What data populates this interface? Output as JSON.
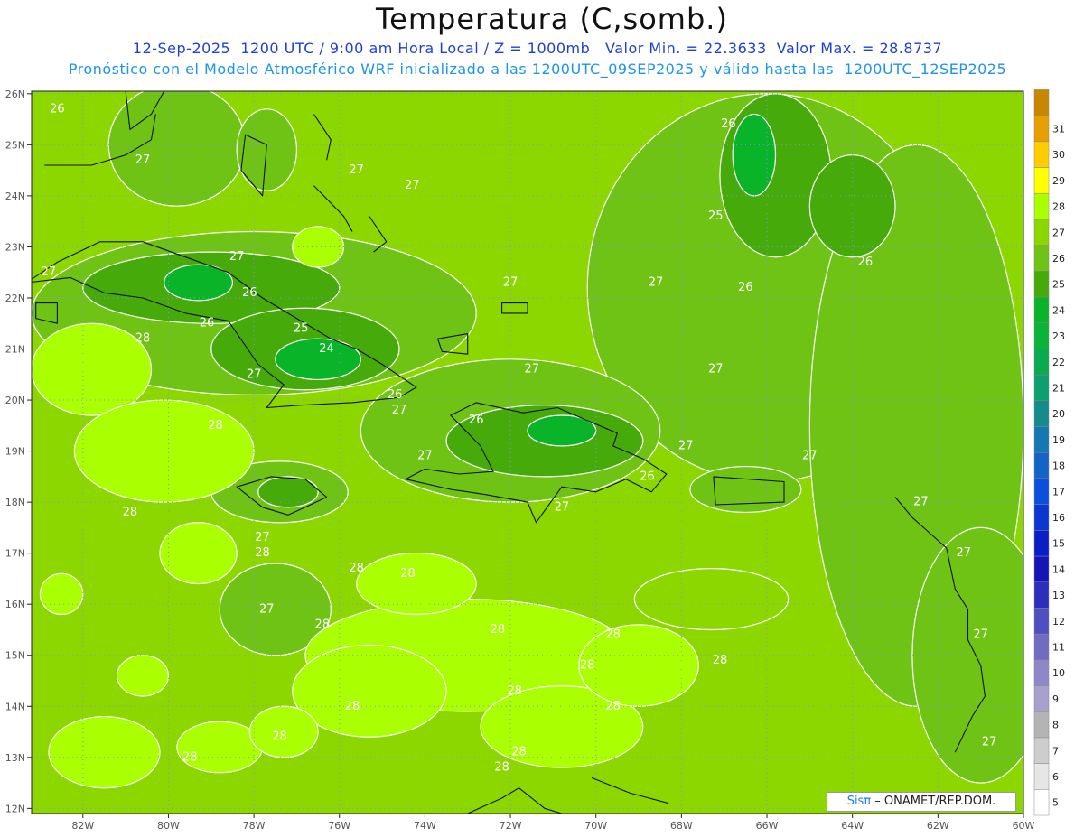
{
  "title": "Temperatura (C,somb.)",
  "subtitle_line1": "12-Sep-2025  1200 UTC / 9:00 am Hora Local / Z = 1000mb   Valor Min. = 22.3633  Valor Max. = 28.8737",
  "subtitle_line2": "Pronóstico con el Modelo Atmosférico WRF inicializado a las 1200UTC_09SEP2025 y válido hasta las  1200UTC_12SEP2025",
  "credit": {
    "brand": "Sisπ",
    "org": " – ONAMET/REP.DOM."
  },
  "map": {
    "lon_ticks": [
      "82W",
      "80W",
      "78W",
      "76W",
      "74W",
      "72W",
      "70W",
      "68W",
      "66W",
      "64W",
      "62W",
      "60W"
    ],
    "lat_ticks": [
      "12N",
      "13N",
      "14N",
      "15N",
      "16N",
      "17N",
      "18N",
      "19N",
      "20N",
      "21N",
      "22N",
      "23N",
      "24N",
      "25N",
      "26N"
    ],
    "lon_values": [
      -82,
      -80,
      -78,
      -76,
      -74,
      -72,
      -70,
      -68,
      -66,
      -64,
      -62,
      -60
    ],
    "lat_values": [
      12,
      13,
      14,
      15,
      16,
      17,
      18,
      19,
      20,
      21,
      22,
      23,
      24,
      25,
      26
    ],
    "lon_range": [
      -83.2,
      -60
    ],
    "lat_range": [
      11.9,
      26.05
    ],
    "background_level": 27,
    "regions": [
      {
        "level": 26,
        "lon": -66,
        "lat": 22.2,
        "rx": 4.2,
        "ry": 3.8
      },
      {
        "level": 26,
        "lon": -62.5,
        "lat": 19.5,
        "rx": 2.5,
        "ry": 5.5
      },
      {
        "level": 26,
        "lon": -61,
        "lat": 15,
        "rx": 1.6,
        "ry": 2.5
      },
      {
        "level": 25,
        "lon": -65.8,
        "lat": 24.4,
        "rx": 1.3,
        "ry": 1.6
      },
      {
        "level": 25,
        "lon": -64,
        "lat": 23.8,
        "rx": 1,
        "ry": 1
      },
      {
        "level": 24,
        "lon": -66.3,
        "lat": 24.8,
        "rx": 0.5,
        "ry": 0.8
      },
      {
        "level": 26,
        "lon": -78,
        "lat": 21.7,
        "rx": 5.2,
        "ry": 1.6
      },
      {
        "level": 25,
        "lon": -79,
        "lat": 22.2,
        "rx": 3,
        "ry": 0.7
      },
      {
        "level": 25,
        "lon": -76.8,
        "lat": 21,
        "rx": 2.2,
        "ry": 0.8
      },
      {
        "level": 24,
        "lon": -79.3,
        "lat": 22.3,
        "rx": 0.8,
        "ry": 0.35
      },
      {
        "level": 24,
        "lon": -76.5,
        "lat": 20.8,
        "rx": 1,
        "ry": 0.4
      },
      {
        "level": 26,
        "lon": -72,
        "lat": 19.4,
        "rx": 3.5,
        "ry": 1.4
      },
      {
        "level": 25,
        "lon": -71.2,
        "lat": 19.2,
        "rx": 2.3,
        "ry": 0.7
      },
      {
        "level": 24,
        "lon": -70.8,
        "lat": 19.4,
        "rx": 0.8,
        "ry": 0.3
      },
      {
        "level": 26,
        "lon": -66.5,
        "lat": 18.25,
        "rx": 1.3,
        "ry": 0.45
      },
      {
        "level": 26,
        "lon": -77.4,
        "lat": 18.2,
        "rx": 1.6,
        "ry": 0.6
      },
      {
        "level": 25,
        "lon": -77.2,
        "lat": 18.2,
        "rx": 0.7,
        "ry": 0.3
      },
      {
        "level": 26,
        "lon": -77.5,
        "lat": 15.9,
        "rx": 1.3,
        "ry": 0.9
      },
      {
        "level": 26,
        "lon": -79.8,
        "lat": 25,
        "rx": 1.6,
        "ry": 1.2
      },
      {
        "level": 26,
        "lon": -77.7,
        "lat": 24.9,
        "rx": 0.7,
        "ry": 0.8
      },
      {
        "level": 27,
        "lon": -67.3,
        "lat": 16.1,
        "rx": 1.8,
        "ry": 0.6
      },
      {
        "level": 28,
        "lon": -81.8,
        "lat": 20.6,
        "rx": 1.4,
        "ry": 0.9
      },
      {
        "level": 28,
        "lon": -80.1,
        "lat": 19,
        "rx": 2.1,
        "ry": 1
      },
      {
        "level": 28,
        "lon": -76.5,
        "lat": 23,
        "rx": 0.6,
        "ry": 0.4
      },
      {
        "level": 28,
        "lon": -73,
        "lat": 15,
        "rx": 3.8,
        "ry": 1.1
      },
      {
        "level": 28,
        "lon": -75.3,
        "lat": 14.3,
        "rx": 1.8,
        "ry": 0.9
      },
      {
        "level": 28,
        "lon": -70.8,
        "lat": 13.6,
        "rx": 1.9,
        "ry": 0.8
      },
      {
        "level": 28,
        "lon": -69,
        "lat": 14.8,
        "rx": 1.4,
        "ry": 0.8
      },
      {
        "level": 28,
        "lon": -74.2,
        "lat": 16.4,
        "rx": 1.4,
        "ry": 0.6
      },
      {
        "level": 28,
        "lon": -79.3,
        "lat": 17,
        "rx": 0.9,
        "ry": 0.6
      },
      {
        "level": 28,
        "lon": -81.5,
        "lat": 13.1,
        "rx": 1.3,
        "ry": 0.7
      },
      {
        "level": 28,
        "lon": -78.8,
        "lat": 13.2,
        "rx": 1,
        "ry": 0.5
      },
      {
        "level": 28,
        "lon": -77.3,
        "lat": 13.5,
        "rx": 0.8,
        "ry": 0.5
      },
      {
        "level": 28,
        "lon": -82.5,
        "lat": 16.2,
        "rx": 0.5,
        "ry": 0.4
      },
      {
        "level": 28,
        "lon": -80.6,
        "lat": 14.6,
        "rx": 0.6,
        "ry": 0.4
      }
    ],
    "contour_labels": [
      {
        "text": "26",
        "lon": -82.6,
        "lat": 25.7
      },
      {
        "text": "27",
        "lon": -80.6,
        "lat": 24.7
      },
      {
        "text": "27",
        "lon": -78.4,
        "lat": 22.8
      },
      {
        "text": "27",
        "lon": -82.8,
        "lat": 22.5
      },
      {
        "text": "26",
        "lon": -78.1,
        "lat": 22.1
      },
      {
        "text": "26",
        "lon": -79.1,
        "lat": 21.5
      },
      {
        "text": "25",
        "lon": -76.9,
        "lat": 21.4
      },
      {
        "text": "24",
        "lon": -76.3,
        "lat": 21
      },
      {
        "text": "27",
        "lon": -78,
        "lat": 20.5
      },
      {
        "text": "26",
        "lon": -74.7,
        "lat": 20.1
      },
      {
        "text": "27",
        "lon": -74.6,
        "lat": 19.8
      },
      {
        "text": "28",
        "lon": -80.6,
        "lat": 21.2
      },
      {
        "text": "28",
        "lon": -78.9,
        "lat": 19.5
      },
      {
        "text": "27",
        "lon": -74.3,
        "lat": 24.2
      },
      {
        "text": "27",
        "lon": -75.6,
        "lat": 24.5
      },
      {
        "text": "27",
        "lon": -72,
        "lat": 22.3
      },
      {
        "text": "27",
        "lon": -68.6,
        "lat": 22.3
      },
      {
        "text": "27",
        "lon": -71.5,
        "lat": 20.6
      },
      {
        "text": "26",
        "lon": -72.8,
        "lat": 19.6
      },
      {
        "text": "27",
        "lon": -74,
        "lat": 18.9
      },
      {
        "text": "27",
        "lon": -67.9,
        "lat": 19.1
      },
      {
        "text": "26",
        "lon": -68.8,
        "lat": 18.5
      },
      {
        "text": "27",
        "lon": -70.8,
        "lat": 17.9
      },
      {
        "text": "27",
        "lon": -65,
        "lat": 18.9
      },
      {
        "text": "26",
        "lon": -66.9,
        "lat": 25.4
      },
      {
        "text": "25",
        "lon": -67.2,
        "lat": 23.6
      },
      {
        "text": "26",
        "lon": -63.7,
        "lat": 22.7
      },
      {
        "text": "26",
        "lon": -66.5,
        "lat": 22.2
      },
      {
        "text": "27",
        "lon": -67.2,
        "lat": 20.6
      },
      {
        "text": "27",
        "lon": -62.4,
        "lat": 18
      },
      {
        "text": "27",
        "lon": -61.4,
        "lat": 17
      },
      {
        "text": "27",
        "lon": -61,
        "lat": 15.4
      },
      {
        "text": "27",
        "lon": -60.8,
        "lat": 13.3
      },
      {
        "text": "28",
        "lon": -80.9,
        "lat": 17.8
      },
      {
        "text": "27",
        "lon": -77.8,
        "lat": 17.3
      },
      {
        "text": "28",
        "lon": -77.8,
        "lat": 17
      },
      {
        "text": "27",
        "lon": -77.7,
        "lat": 15.9
      },
      {
        "text": "28",
        "lon": -74.4,
        "lat": 16.6
      },
      {
        "text": "28",
        "lon": -75.6,
        "lat": 16.7
      },
      {
        "text": "28",
        "lon": -76.4,
        "lat": 15.6
      },
      {
        "text": "28",
        "lon": -72.3,
        "lat": 15.5
      },
      {
        "text": "28",
        "lon": -69.6,
        "lat": 15.4
      },
      {
        "text": "28",
        "lon": -70.2,
        "lat": 14.8
      },
      {
        "text": "28",
        "lon": -67.1,
        "lat": 14.9
      },
      {
        "text": "28",
        "lon": -71.9,
        "lat": 14.3
      },
      {
        "text": "28",
        "lon": -69.6,
        "lat": 14
      },
      {
        "text": "28",
        "lon": -75.7,
        "lat": 14
      },
      {
        "text": "28",
        "lon": -77.4,
        "lat": 13.4
      },
      {
        "text": "28",
        "lon": -79.5,
        "lat": 13
      },
      {
        "text": "28",
        "lon": -71.8,
        "lat": 13.1
      },
      {
        "text": "28",
        "lon": -72.2,
        "lat": 12.8
      }
    ],
    "land_outlines": [
      {
        "name": "cuba",
        "closed": true,
        "points": [
          [
            -84.9,
            21.9
          ],
          [
            -83.5,
            22.2
          ],
          [
            -82.6,
            22.7
          ],
          [
            -81.6,
            23.1
          ],
          [
            -80.6,
            23.1
          ],
          [
            -79.6,
            22.8
          ],
          [
            -78.6,
            22.5
          ],
          [
            -77.8,
            22.0
          ],
          [
            -77.0,
            21.6
          ],
          [
            -76.2,
            21.2
          ],
          [
            -75.6,
            21.0
          ],
          [
            -75.0,
            20.7
          ],
          [
            -74.2,
            20.25
          ],
          [
            -74.6,
            20.05
          ],
          [
            -75.7,
            19.95
          ],
          [
            -76.9,
            19.9
          ],
          [
            -77.7,
            19.85
          ],
          [
            -77.3,
            20.3
          ],
          [
            -77.9,
            20.7
          ],
          [
            -78.6,
            21.55
          ],
          [
            -79.6,
            21.7
          ],
          [
            -80.6,
            22.0
          ],
          [
            -81.5,
            22.1
          ],
          [
            -82.3,
            22.4
          ],
          [
            -83.3,
            22.3
          ],
          [
            -84.4,
            21.9
          ]
        ]
      },
      {
        "name": "isla-juventud",
        "closed": true,
        "points": [
          [
            -83.1,
            21.9
          ],
          [
            -82.6,
            21.9
          ],
          [
            -82.6,
            21.5
          ],
          [
            -83.1,
            21.6
          ]
        ]
      },
      {
        "name": "hispaniola",
        "closed": true,
        "points": [
          [
            -74.45,
            18.45
          ],
          [
            -73.4,
            18.25
          ],
          [
            -72.6,
            18.15
          ],
          [
            -71.6,
            18.0
          ],
          [
            -71.4,
            17.6
          ],
          [
            -70.8,
            18.3
          ],
          [
            -70.0,
            18.2
          ],
          [
            -69.3,
            18.45
          ],
          [
            -68.7,
            18.2
          ],
          [
            -68.35,
            18.55
          ],
          [
            -68.9,
            18.85
          ],
          [
            -69.6,
            19.1
          ],
          [
            -69.5,
            19.35
          ],
          [
            -70.2,
            19.6
          ],
          [
            -70.9,
            19.85
          ],
          [
            -71.7,
            19.75
          ],
          [
            -72.8,
            19.95
          ],
          [
            -73.4,
            19.7
          ],
          [
            -72.7,
            19.1
          ],
          [
            -72.4,
            18.6
          ],
          [
            -73.2,
            18.55
          ],
          [
            -74.0,
            18.65
          ]
        ]
      },
      {
        "name": "jamaica",
        "closed": true,
        "points": [
          [
            -78.4,
            18.3
          ],
          [
            -77.6,
            18.5
          ],
          [
            -76.8,
            18.45
          ],
          [
            -76.3,
            18.1
          ],
          [
            -76.8,
            17.9
          ],
          [
            -77.2,
            17.75
          ],
          [
            -77.8,
            17.9
          ]
        ]
      },
      {
        "name": "puerto-rico",
        "closed": true,
        "points": [
          [
            -67.25,
            18.5
          ],
          [
            -65.6,
            18.4
          ],
          [
            -65.6,
            18.0
          ],
          [
            -67.2,
            17.95
          ]
        ]
      },
      {
        "name": "andros",
        "closed": true,
        "points": [
          [
            -78.2,
            25.2
          ],
          [
            -77.7,
            25.0
          ],
          [
            -77.8,
            24.0
          ],
          [
            -78.3,
            24.5
          ]
        ]
      },
      {
        "name": "eleuthera",
        "closed": false,
        "points": [
          [
            -76.6,
            25.6
          ],
          [
            -76.2,
            25.1
          ],
          [
            -76.3,
            24.7
          ]
        ]
      },
      {
        "name": "great-exuma",
        "closed": false,
        "points": [
          [
            -76.6,
            24.2
          ],
          [
            -75.9,
            23.6
          ],
          [
            -75.7,
            23.3
          ]
        ]
      },
      {
        "name": "long-island",
        "closed": false,
        "points": [
          [
            -75.3,
            23.6
          ],
          [
            -74.9,
            23.1
          ],
          [
            -75.2,
            22.9
          ]
        ]
      },
      {
        "name": "inagua",
        "closed": true,
        "points": [
          [
            -73.7,
            21.2
          ],
          [
            -73.0,
            21.3
          ],
          [
            -73.0,
            20.9
          ],
          [
            -73.6,
            20.95
          ]
        ]
      },
      {
        "name": "turks-caicos",
        "closed": true,
        "points": [
          [
            -72.2,
            21.9
          ],
          [
            -71.6,
            21.9
          ],
          [
            -71.6,
            21.7
          ],
          [
            -72.2,
            21.7
          ]
        ]
      },
      {
        "name": "florida-keys",
        "closed": false,
        "points": [
          [
            -82.9,
            24.6
          ],
          [
            -81.8,
            24.6
          ],
          [
            -81.0,
            24.8
          ],
          [
            -80.4,
            25.1
          ],
          [
            -80.3,
            25.6
          ]
        ]
      },
      {
        "name": "florida",
        "closed": false,
        "points": [
          [
            -81.0,
            26.05
          ],
          [
            -80.9,
            25.3
          ],
          [
            -80.4,
            25.6
          ],
          [
            -80.1,
            26.05
          ]
        ]
      },
      {
        "name": "south-america",
        "closed": false,
        "points": [
          [
            -73.0,
            11.9
          ],
          [
            -72.2,
            12.2
          ],
          [
            -71.8,
            12.4
          ],
          [
            -71.2,
            12.0
          ],
          [
            -70.8,
            11.9
          ]
        ]
      },
      {
        "name": "leeward-islands",
        "closed": false,
        "points": [
          [
            -63.0,
            18.1
          ],
          [
            -62.6,
            17.7
          ],
          [
            -61.8,
            17.1
          ],
          [
            -61.6,
            16.3
          ],
          [
            -61.3,
            15.9
          ],
          [
            -61.3,
            15.3
          ],
          [
            -61.0,
            14.8
          ],
          [
            -60.9,
            14.2
          ],
          [
            -61.2,
            13.8
          ],
          [
            -61.6,
            13.1
          ]
        ]
      },
      {
        "name": "abc-islands",
        "closed": false,
        "points": [
          [
            -70.1,
            12.6
          ],
          [
            -69.2,
            12.3
          ],
          [
            -68.3,
            12.1
          ]
        ]
      }
    ],
    "colorbar": [
      {
        "label": "5",
        "color": "#ffffff"
      },
      {
        "label": "6",
        "color": "#e6e6e6"
      },
      {
        "label": "7",
        "color": "#cdcdcd"
      },
      {
        "label": "8",
        "color": "#b4b4b4"
      },
      {
        "label": "9",
        "color": "#a8a0cd"
      },
      {
        "label": "10",
        "color": "#8f88c8"
      },
      {
        "label": "11",
        "color": "#6f6cc2"
      },
      {
        "label": "12",
        "color": "#4f4fc0"
      },
      {
        "label": "13",
        "color": "#2e2ebc"
      },
      {
        "label": "14",
        "color": "#1414b8"
      },
      {
        "label": "15",
        "color": "#0a1ec8"
      },
      {
        "label": "16",
        "color": "#0a37d2"
      },
      {
        "label": "17",
        "color": "#0a50dc"
      },
      {
        "label": "18",
        "color": "#1464c8"
      },
      {
        "label": "19",
        "color": "#1478b4"
      },
      {
        "label": "20",
        "color": "#148c8c"
      },
      {
        "label": "21",
        "color": "#0ca070"
      },
      {
        "label": "22",
        "color": "#0aaa50"
      },
      {
        "label": "23",
        "color": "#0ab438"
      },
      {
        "label": "24",
        "color": "#0ab428"
      },
      {
        "label": "25",
        "color": "#46aa0a"
      },
      {
        "label": "26",
        "color": "#6ec314"
      },
      {
        "label": "27",
        "color": "#8cd700"
      },
      {
        "label": "28",
        "color": "#aaff00"
      },
      {
        "label": "29",
        "color": "#ffff00"
      },
      {
        "label": "30",
        "color": "#ffcd00"
      },
      {
        "label": "31",
        "color": "#e6a000"
      },
      {
        "label": "",
        "color": "#c88700"
      }
    ]
  }
}
